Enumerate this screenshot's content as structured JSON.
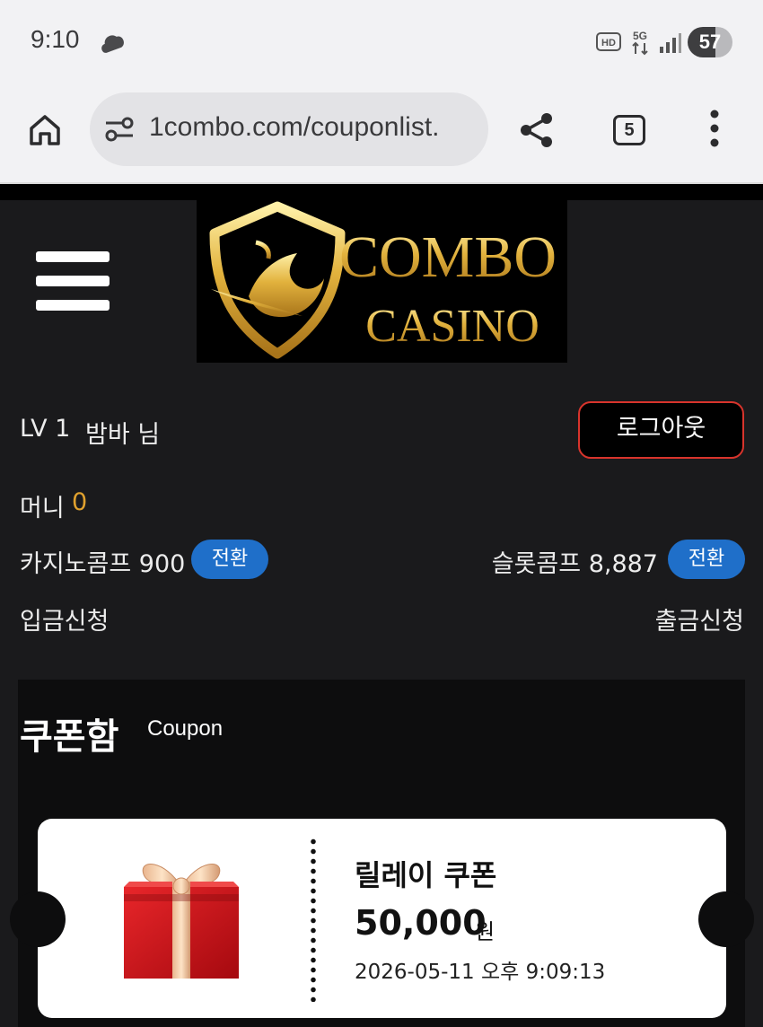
{
  "status_bar": {
    "time": "9:10",
    "battery": "57",
    "icons": [
      "cloud-icon",
      "hd-voice-icon",
      "5g-icon",
      "signal-icon",
      "battery-icon"
    ]
  },
  "browser": {
    "url": "1combo.com/couponlist.",
    "tab_count": "5",
    "icons": [
      "home-icon",
      "site-settings-icon",
      "share-icon",
      "tabs-icon",
      "more-vert-icon"
    ]
  },
  "header": {
    "logo_text_line1": "COMBO",
    "logo_text_line2": "CASINO",
    "menu_icon": "hamburger-icon"
  },
  "user": {
    "level": "LV 1",
    "name": "밤바 님",
    "logout_label": "로그아웃",
    "money_label": "머니",
    "money_value": "0",
    "casino_comp_label": "카지노콤프 900",
    "slot_comp_label": "슬롯콤프 8,887",
    "convert_label": "전환",
    "deposit_label": "입금신청",
    "withdraw_label": "출금신청"
  },
  "coupon_box": {
    "title": "쿠폰함",
    "subtitle": "Coupon",
    "coupons": [
      {
        "name": "릴레이 쿠폰",
        "amount": "50,000",
        "unit": "원",
        "date": "2026-05-11 오후 9:09:13",
        "icon": "gift-box-icon"
      }
    ]
  },
  "colors": {
    "background": "#1a1a1c",
    "accent_gold": "#e0a12e",
    "convert_blue": "#1f6fc9",
    "logout_red": "#d8342c"
  }
}
